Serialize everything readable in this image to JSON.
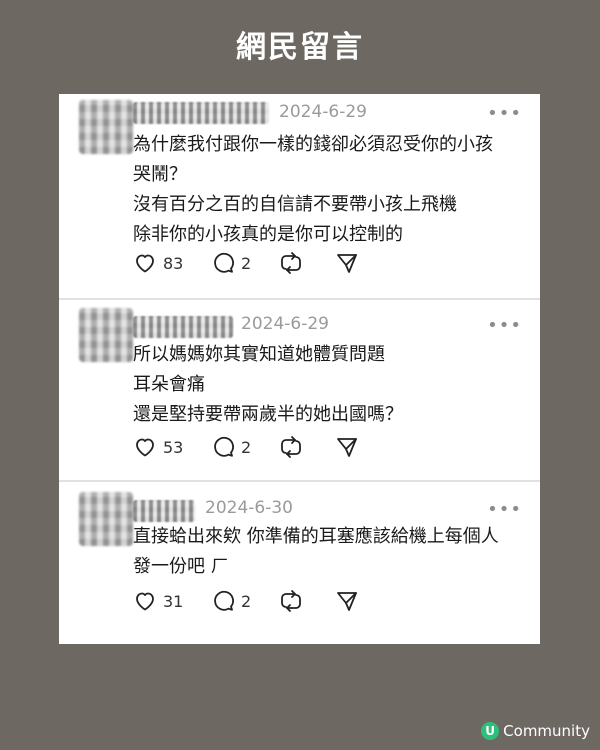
{
  "page": {
    "title": "網民留言"
  },
  "brand": {
    "logo_mark": "U",
    "logo_text": "Community",
    "accent": "#2cc07a"
  },
  "posts": [
    {
      "date": "2024-6-29",
      "lines": [
        "為什麼我付跟你一樣的錢卻必須忍受你的小孩",
        "哭鬧？",
        "沒有百分之百的自信請不要帶小孩上飛機",
        "除非你的小孩真的是你可以控制的"
      ],
      "likes": "83",
      "replies": "2"
    },
    {
      "date": "2024-6-29",
      "lines": [
        "所以媽媽妳其實知道她體質問題",
        "耳朵會痛",
        "還是堅持要帶兩歲半的她出國嗎？"
      ],
      "likes": "53",
      "replies": "2"
    },
    {
      "date": "2024-6-30",
      "lines": [
        "直接蛤出來欸 你準備的耳塞應該給機上每個人",
        "發一份吧 ㄏ"
      ],
      "likes": "31",
      "replies": "2"
    }
  ],
  "icons": {
    "like": "heart-icon",
    "reply": "comment-icon",
    "repost": "repost-icon",
    "share": "send-icon",
    "more": "more-icon"
  },
  "more_label": "•••"
}
